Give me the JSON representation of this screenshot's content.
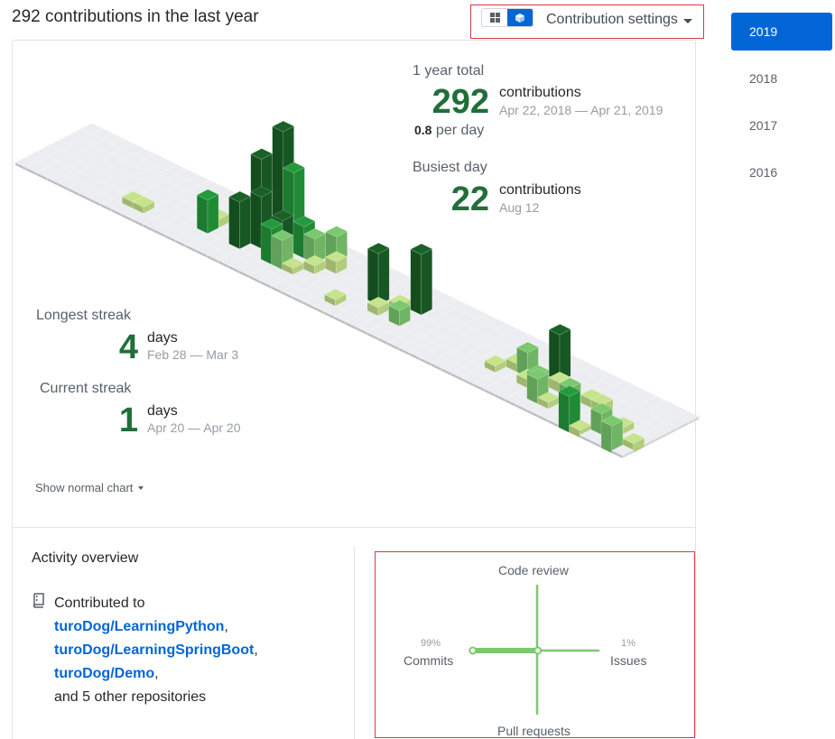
{
  "header": {
    "title": "292 contributions in the last year",
    "settings_label": "Contribution settings",
    "view_toggle": [
      "grid-view-icon",
      "isometric-view-icon"
    ]
  },
  "years": [
    "2019",
    "2018",
    "2017",
    "2016"
  ],
  "selected_year": "2019",
  "stats": {
    "total_label": "1 year total",
    "total_value": "292",
    "total_unit": "contributions",
    "total_range": "Apr 22, 2018 — Apr 21, 2019",
    "per_day_value": "0.8",
    "per_day_label": "per day",
    "busiest_label": "Busiest day",
    "busiest_value": "22",
    "busiest_unit": "contributions",
    "busiest_date": "Aug 12",
    "longest_label": "Longest streak",
    "longest_value": "4",
    "longest_unit": "days",
    "longest_range": "Feb 28 — Mar 3",
    "current_label": "Current streak",
    "current_value": "1",
    "current_unit": "days",
    "current_range": "Apr 20 — Apr 20"
  },
  "show_normal_label": "Show normal chart",
  "activity": {
    "title": "Activity overview",
    "contributed_to": "Contributed to",
    "repos": [
      "turoDog/LearningPython",
      "turoDog/LearningSpringBoot",
      "turoDog/Demo"
    ],
    "comma": ",",
    "others": "and 5 other repositories"
  },
  "radar": {
    "top": "Code review",
    "bottom": "Pull requests",
    "left": "Commits",
    "right": "Issues",
    "left_pct": "99%",
    "right_pct": "1%",
    "left_value": 0.99,
    "right_value": 0.01
  },
  "colors": {
    "level1": "#c6e48b",
    "level2": "#7bc96f",
    "level3": "#239a3b",
    "level4": "#196127",
    "empty": "#ebedf0",
    "accent": "#0366d6",
    "highlight": "#d73a49"
  }
}
